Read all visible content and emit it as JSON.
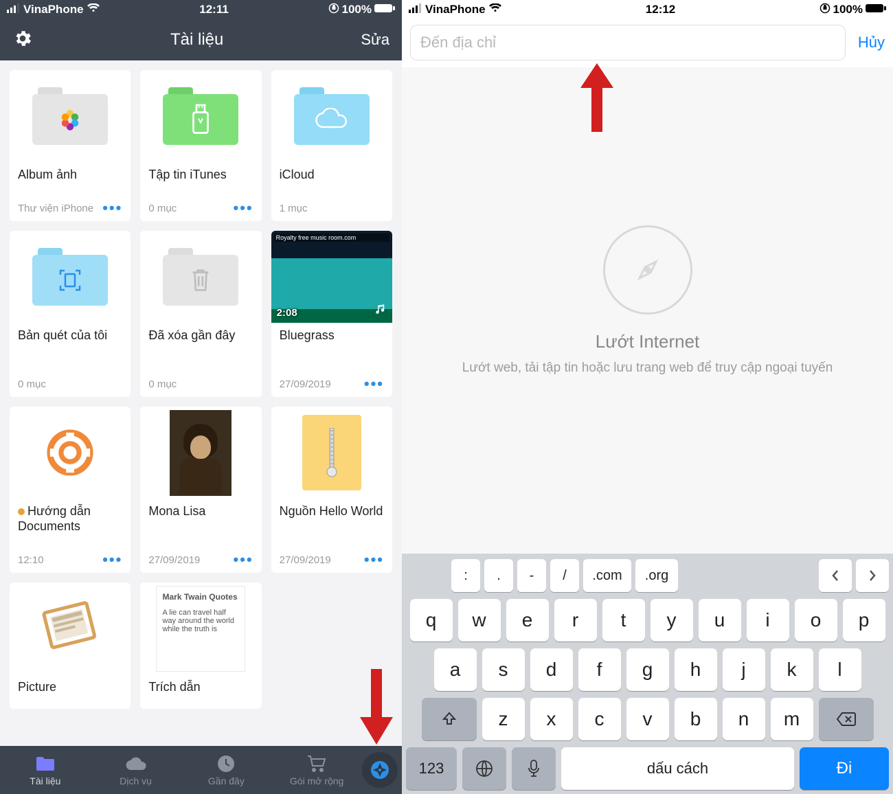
{
  "left": {
    "status": {
      "carrier": "VinaPhone",
      "time": "12:11",
      "battery": "100%"
    },
    "nav": {
      "title": "Tài liệu",
      "edit": "Sửa"
    },
    "tiles": [
      {
        "title": "Album ảnh",
        "sub": "Thư viện iPhone",
        "dots": true
      },
      {
        "title": "Tập tin iTunes",
        "sub": "0 mục",
        "dots": true
      },
      {
        "title": "iCloud",
        "sub": "1 mục",
        "dots": false
      },
      {
        "title": "Bản quét của tôi",
        "sub": "0 mục",
        "dots": false
      },
      {
        "title": "Đã xóa gần đây",
        "sub": "0 mục",
        "dots": false
      },
      {
        "title": "Bluegrass",
        "sub": "27/09/2019",
        "dots": true,
        "duration": "2:08",
        "thumb_text": "Royalty free music room.com"
      },
      {
        "title": "Hướng dẫn Documents",
        "sub": "12:10",
        "dots": true,
        "badge": true
      },
      {
        "title": "Mona Lisa",
        "sub": "27/09/2019",
        "dots": true
      },
      {
        "title": "Nguồn Hello World",
        "sub": "27/09/2019",
        "dots": true
      },
      {
        "title": "Picture",
        "sub": "",
        "dots": false
      },
      {
        "title": "Trích dẫn",
        "sub": "",
        "dots": false,
        "note_title": "Mark Twain Quotes",
        "note_body": "A lie can travel half way around the world while the truth is"
      }
    ],
    "tabs": [
      {
        "label": "Tài liệu"
      },
      {
        "label": "Dịch vụ"
      },
      {
        "label": "Gần đây"
      },
      {
        "label": "Gói mở rộng"
      }
    ]
  },
  "right": {
    "status": {
      "carrier": "VinaPhone",
      "time": "12:12",
      "battery": "100%"
    },
    "search": {
      "placeholder": "Đến địa chỉ",
      "cancel": "Hủy"
    },
    "empty": {
      "title": "Lướt Internet",
      "sub": "Lướt web, tải tập tin hoặc lưu trang web để truy cập ngoại tuyến"
    },
    "keyboard": {
      "accessory": [
        ":",
        ".",
        "-",
        "/",
        ".com",
        ".org"
      ],
      "row1": [
        "q",
        "w",
        "e",
        "r",
        "t",
        "y",
        "u",
        "i",
        "o",
        "p"
      ],
      "row2": [
        "a",
        "s",
        "d",
        "f",
        "g",
        "h",
        "j",
        "k",
        "l"
      ],
      "row3": [
        "z",
        "x",
        "c",
        "v",
        "b",
        "n",
        "m"
      ],
      "bottom": {
        "numbers": "123",
        "space": "dấu cách",
        "go": "Đi"
      }
    }
  }
}
